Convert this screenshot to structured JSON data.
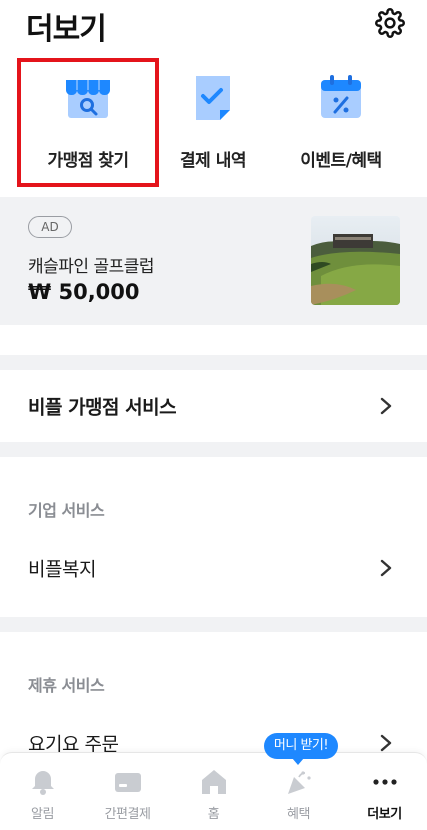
{
  "header": {
    "title": "더보기"
  },
  "quick_menu": [
    {
      "label": "가맹점 찾기",
      "icon": "store-search-icon"
    },
    {
      "label": "결제 내역",
      "icon": "receipt-check-icon"
    },
    {
      "label": "이벤트/혜택",
      "icon": "calendar-percent-icon"
    }
  ],
  "ad": {
    "badge": "AD",
    "name": "캐슬파인 골프클럽",
    "price": "₩ 50,000"
  },
  "menu": {
    "franchise_service": "비플 가맹점 서비스",
    "corporate_header": "기업 서비스",
    "corporate_item": "비플복지",
    "partner_header": "제휴 서비스",
    "partner_item": "요기요 주문"
  },
  "tooltip": "머니 받기!",
  "tabs": [
    {
      "label": "알림",
      "icon": "bell-icon",
      "active": false
    },
    {
      "label": "간편결제",
      "icon": "card-icon",
      "active": false
    },
    {
      "label": "홈",
      "icon": "home-icon",
      "active": false
    },
    {
      "label": "혜택",
      "icon": "party-popper-icon",
      "active": false
    },
    {
      "label": "더보기",
      "icon": "more-dots-icon",
      "active": true
    }
  ],
  "colors": {
    "accent": "#1e88ff",
    "highlight": "#e4141b",
    "section_bg": "#f1f2f4"
  }
}
